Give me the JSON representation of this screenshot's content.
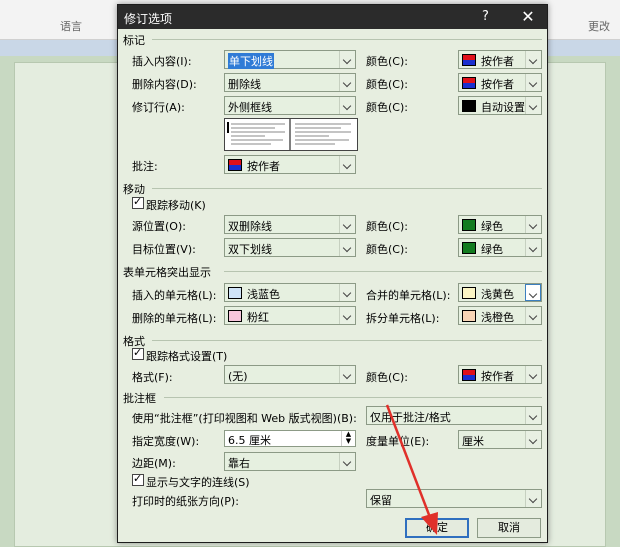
{
  "ribbon": {
    "left_label": "语言",
    "right_label": "更改"
  },
  "dialog": {
    "title": "修订选项",
    "help": "?",
    "close": "✕",
    "markup": {
      "header": "标记",
      "insertions_label": "插入内容(I):",
      "insertions_value": "单下划线",
      "deletions_label": "删除内容(D):",
      "deletions_value": "删除线",
      "changed_lines_label": "修订行(A):",
      "changed_lines_value": "外侧框线",
      "comments_label": "批注:",
      "comments_value": "按作者",
      "color_label": "颜色(C):",
      "color1": "按作者",
      "color2": "按作者",
      "color3": "自动设置"
    },
    "moves": {
      "header": "移动",
      "track_label": "跟踪移动(K)",
      "from_label": "源位置(O):",
      "from_value": "双删除线",
      "to_label": "目标位置(V):",
      "to_value": "双下划线",
      "color_label": "颜色(C):",
      "from_color": "绿色",
      "to_color": "绿色"
    },
    "table": {
      "header": "表单元格突出显示",
      "inserted_label": "插入的单元格(L):",
      "inserted_value": "浅蓝色",
      "deleted_label": "删除的单元格(L):",
      "deleted_value": "粉红",
      "merged_label": "合并的单元格(L):",
      "merged_value": "浅黄色",
      "split_label": "拆分单元格(L):",
      "split_value": "浅橙色"
    },
    "formatting": {
      "header": "格式",
      "track_label": "跟踪格式设置(T)",
      "format_label": "格式(F):",
      "format_value": "(无)",
      "color_label": "颜色(C):",
      "color_value": "按作者"
    },
    "balloons": {
      "header": "批注框",
      "use_label": "使用“批注框”(打印视图和 Web 版式视图)(B):",
      "use_value": "仅用于批注/格式",
      "width_label": "指定宽度(W):",
      "width_value": "6.5 厘米",
      "unit_label": "度量单位(E):",
      "unit_value": "厘米",
      "margin_label": "边距(M):",
      "margin_value": "靠右",
      "lines_label": "显示与文字的连线(S)",
      "paper_label": "打印时的纸张方向(P):",
      "paper_value": "保留"
    },
    "ok": "确定",
    "cancel": "取消"
  },
  "colors": {
    "blue_swatch": "#cfe3f7",
    "pink_swatch": "#f7c6dc",
    "yellow_swatch": "#fbf5c4",
    "orange_swatch": "#f8d5b6",
    "green_swatch": "#127b1f",
    "annotation_arrow": "#e0302a"
  }
}
